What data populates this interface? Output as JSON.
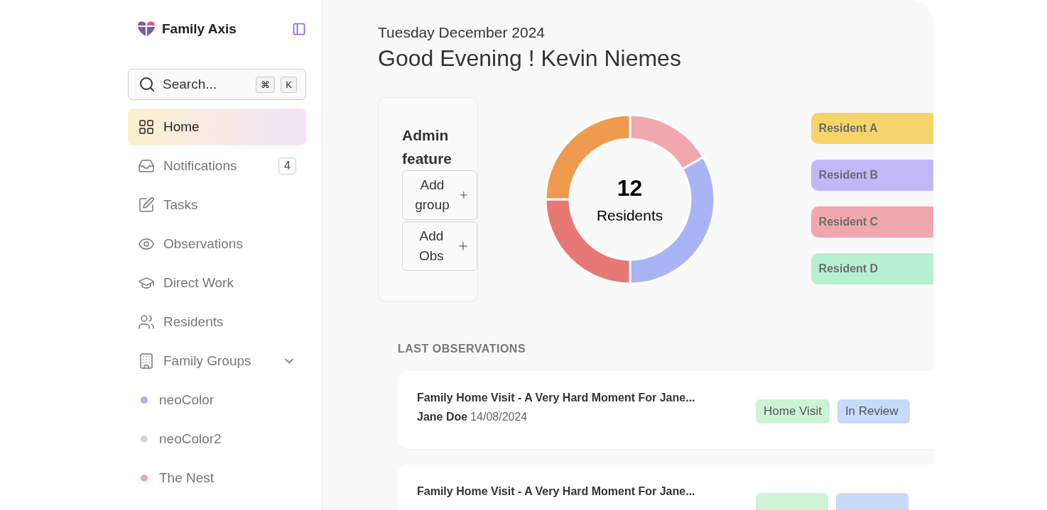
{
  "sidebar": {
    "brand": "Family Axis",
    "search": {
      "placeholder": "Search...",
      "keys": [
        "⌘",
        "K"
      ]
    },
    "items": [
      {
        "kind": "nav",
        "label": "Home",
        "selected": true
      },
      {
        "kind": "nav",
        "label": "Notifications",
        "badge": "4",
        "selected": false
      },
      {
        "kind": "nav",
        "label": "Tasks",
        "selected": false
      },
      {
        "kind": "nav",
        "label": "Observations",
        "selected": false
      },
      {
        "kind": "nav",
        "label": "Direct Work",
        "selected": false
      },
      {
        "kind": "nav",
        "label": "Residents",
        "selected": false
      },
      {
        "kind": "group",
        "label": "Family Groups",
        "expanded": true,
        "selected": false,
        "children": [
          {
            "label": "neoColor",
            "color": "#a9b4f5",
            "selected": false
          },
          {
            "label": "neoColor2",
            "color": "#d6d6d6",
            "selected": false
          },
          {
            "label": "The Nest",
            "color": "#f0a7ae",
            "selected": false
          }
        ]
      }
    ]
  },
  "header": {
    "date": "Tuesday December 2024",
    "greeting": "Good Evening ! Kevin Niemes"
  },
  "admin": {
    "title": "Admin feature",
    "buttons": [
      "Add group",
      "Add Obs"
    ]
  },
  "donut": {
    "count": "12",
    "label": "Residents"
  },
  "residents": [
    {
      "label": "Resident A",
      "color": "#f5d469"
    },
    {
      "label": "Resident B",
      "color": "#c3b8f7"
    },
    {
      "label": "Resident C",
      "color": "#f0a8ae"
    },
    {
      "label": "Resident D",
      "color": "#b7f0d0"
    }
  ],
  "observations": {
    "heading": "LAST OBSERVATIONS",
    "rows": [
      {
        "title": "Family Home Visit - A Very Hard Moment For Jane...",
        "author": "Jane Doe",
        "date": "14/08/2024",
        "tags": [
          {
            "label": "Home Visit",
            "kind": "type"
          },
          {
            "label": "In Review",
            "kind": "status"
          }
        ]
      },
      {
        "title": "Family Home Visit - A Very Hard Moment For Jane...",
        "tags": [
          {
            "kind": "type"
          },
          {
            "kind": "status"
          }
        ]
      }
    ]
  }
}
